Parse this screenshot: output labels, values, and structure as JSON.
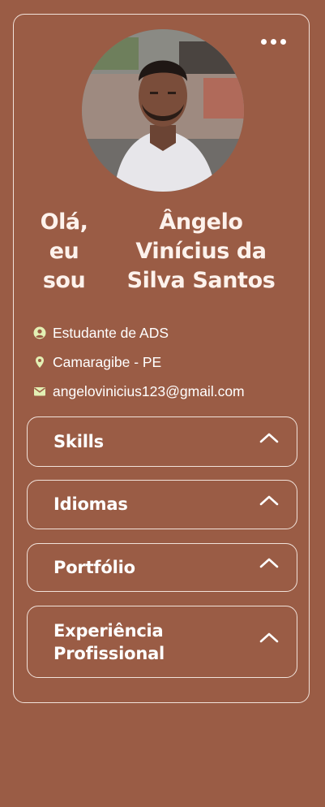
{
  "profile": {
    "greeting": [
      "Olá,",
      "eu",
      "sou"
    ],
    "name_lines": [
      "Ângelo",
      "Vinícius da",
      "Silva Santos"
    ],
    "role": "Estudante de ADS",
    "location": "Camaragibe - PE",
    "email": "angelovinicius123@gmail.com"
  },
  "icons": {
    "menu": "more-horizontal-icon",
    "role": "user-circle-icon",
    "location": "map-pin-icon",
    "email": "mail-icon",
    "section_toggle": "chevron-up-icon"
  },
  "sections": [
    {
      "title": "Skills"
    },
    {
      "title": "Idiomas"
    },
    {
      "title": "Portfólio"
    },
    {
      "title_lines": [
        "Experiência",
        "Profissional"
      ]
    }
  ],
  "colors": {
    "background": "#9a5c45",
    "border": "#f1e2da",
    "icon_accent": "#e3f0b4",
    "text": "#ffffff"
  }
}
